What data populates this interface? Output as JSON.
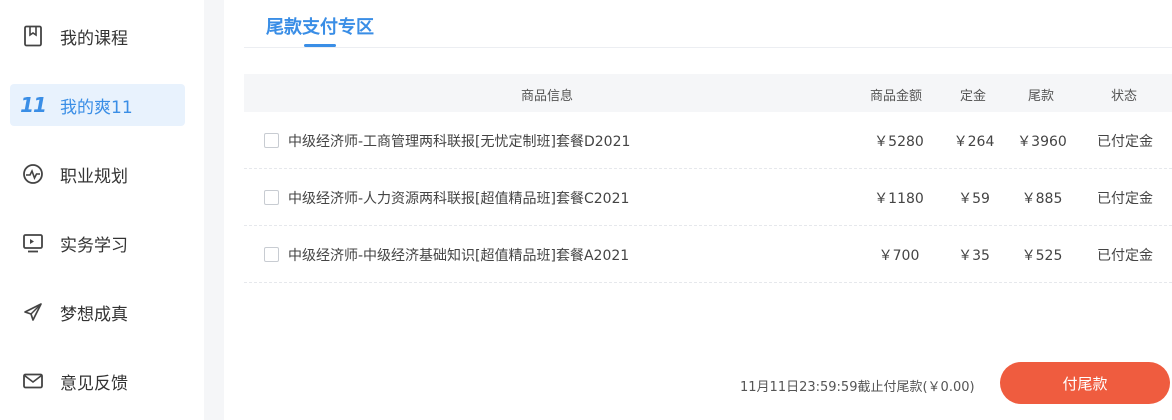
{
  "sidebar": {
    "items": [
      {
        "label": "我的课程",
        "icon": "bookmark-icon"
      },
      {
        "label": "我的爽11",
        "icon": "double-eleven-icon",
        "icon_text": "11",
        "active": true
      },
      {
        "label": "职业规划",
        "icon": "pulse-icon"
      },
      {
        "label": "实务学习",
        "icon": "monitor-icon"
      },
      {
        "label": "梦想成真",
        "icon": "paper-plane-icon"
      },
      {
        "label": "意见反馈",
        "icon": "mail-icon"
      }
    ]
  },
  "main": {
    "tab_label": "尾款支付专区",
    "table": {
      "headers": {
        "info": "商品信息",
        "price": "商品金额",
        "deposit": "定金",
        "balance": "尾款",
        "status": "状态"
      },
      "rows": [
        {
          "name": "中级经济师-工商管理两科联报[无忧定制班]套餐D2021",
          "price": "￥5280",
          "deposit": "￥264",
          "balance": "￥3960",
          "status": "已付定金"
        },
        {
          "name": "中级经济师-人力资源两科联报[超值精品班]套餐C2021",
          "price": "￥1180",
          "deposit": "￥59",
          "balance": "￥885",
          "status": "已付定金"
        },
        {
          "name": "中级经济师-中级经济基础知识[超值精品班]套餐A2021",
          "price": "￥700",
          "deposit": "￥35",
          "balance": "￥525",
          "status": "已付定金"
        }
      ]
    },
    "footer": {
      "deadline_text": "11月11日23:59:59截止付尾款(￥0.00)",
      "pay_button": "付尾款"
    }
  },
  "colors": {
    "accent": "#3a8ee6",
    "pay_button": "#ef5c3f",
    "active_bg": "#e8f2fd"
  }
}
